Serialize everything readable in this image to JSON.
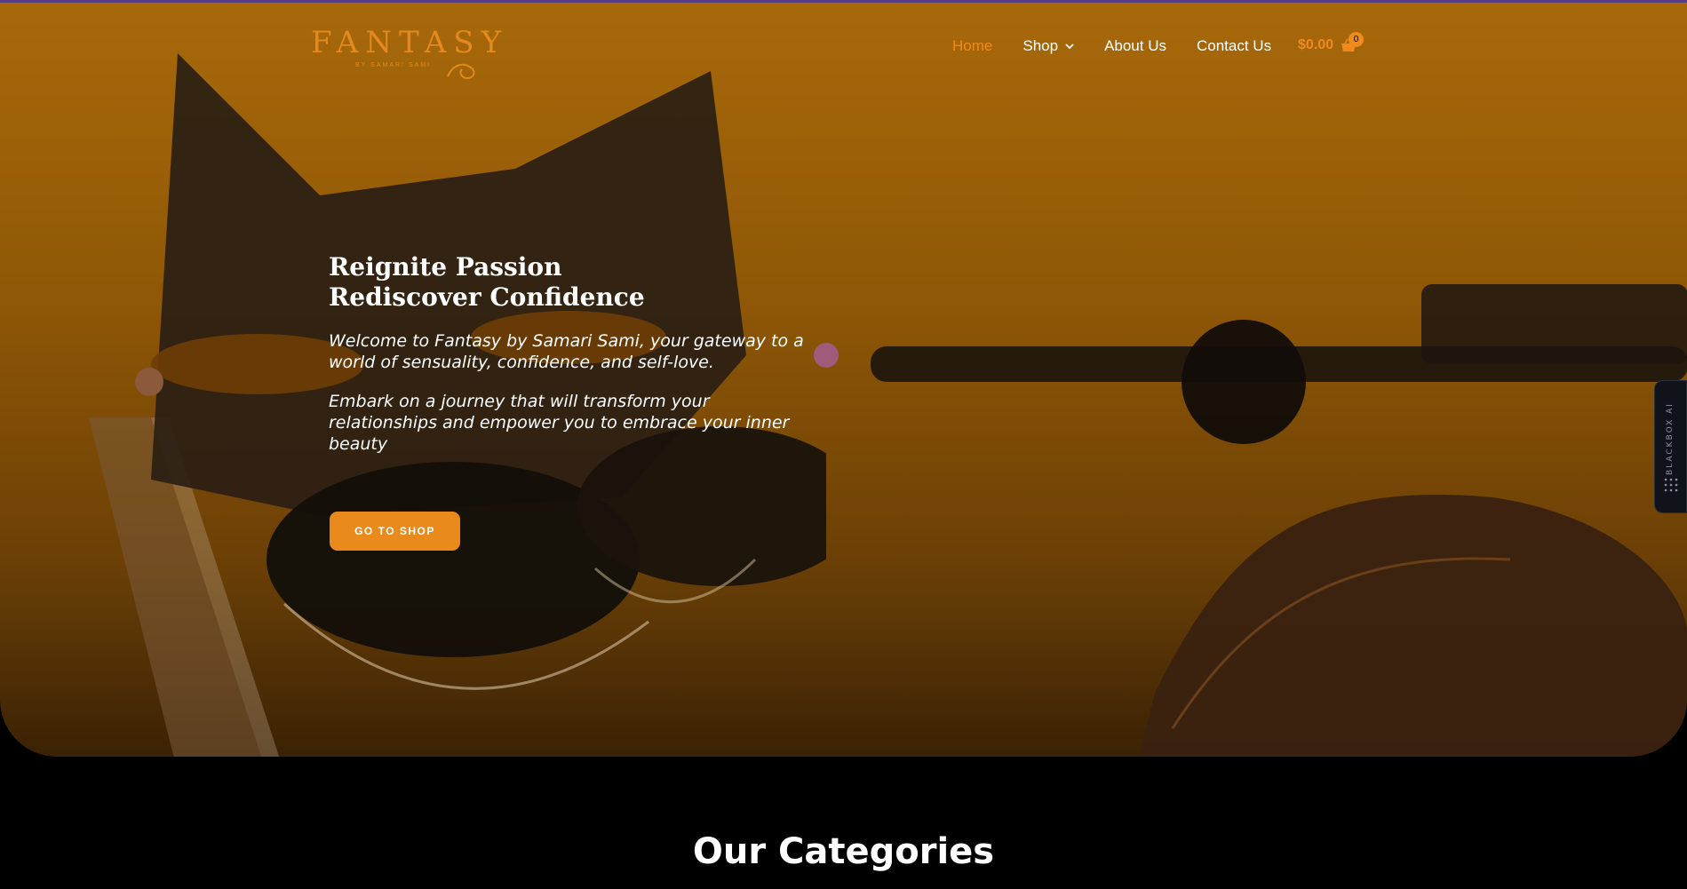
{
  "header": {
    "logo_text": "FANTASY",
    "logo_subtext": "BY SAMARI SAMI",
    "nav": [
      {
        "label": "Home",
        "active": true
      },
      {
        "label": "Shop",
        "has_dropdown": true
      },
      {
        "label": "About Us"
      },
      {
        "label": "Contact Us"
      }
    ],
    "cart": {
      "price": "$0.00",
      "count": "0",
      "icon": "basket-icon"
    }
  },
  "hero": {
    "headline_line1": "Reignite Passion",
    "headline_line2": "Rediscover Confidence",
    "paragraph1": "Welcome to Fantasy by Samari Sami, your gateway to a world of sensuality, confidence, and self-love.",
    "paragraph2": "Embark on a journey that will transform your relationships and empower you to embrace your inner beauty",
    "cta_label": "GO TO SHOP"
  },
  "side_widget": {
    "label": "BLACKBOX AI",
    "icon": "grid-dots-icon"
  },
  "categories": {
    "title": "Our Categories"
  },
  "colors": {
    "accent": "#f08a1d",
    "hero_bg": "#8f5706",
    "page_bg": "#000000"
  }
}
